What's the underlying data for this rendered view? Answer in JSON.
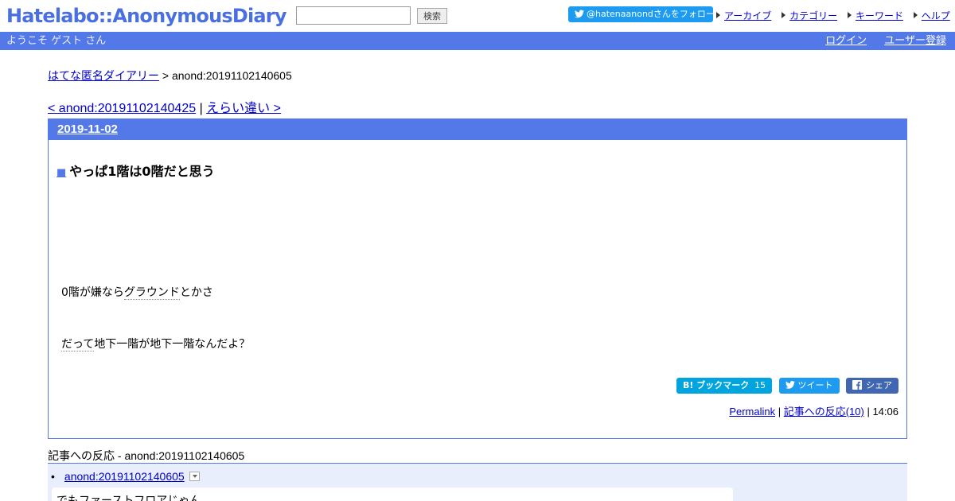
{
  "header": {
    "logo": "Hatelabo::AnonymousDiary",
    "search_placeholder": "",
    "search_button": "検索",
    "follow_label": "@hatenaanondさんをフォロー",
    "links": [
      "アーカイブ",
      "カテゴリー",
      "キーワード",
      "ヘルプ"
    ]
  },
  "nav": {
    "welcome": "ようこそ ゲスト さん",
    "login": "ログイン",
    "register": "ユーザー登録"
  },
  "breadcrumb": {
    "home": "はてな匿名ダイアリー",
    "separator": " > ",
    "current": "anond:20191102140605"
  },
  "pager": {
    "prev": "< anond:20191102140425",
    "separator": " | ",
    "next": "えらい違い >"
  },
  "entry": {
    "date": "2019-11-02",
    "title_marker": "■",
    "title": "やっぱ1階は0階だと思う",
    "line1_a": "0階が嫌なら",
    "line1_kw": "グラウンド",
    "line1_b": "とかさ",
    "line2_kw": "だって",
    "line2_b": "地下一階が地下一階なんだよ？",
    "bookmark_label": "B! ブックマーク",
    "bookmark_count": "15",
    "tweet_label": "ツイート",
    "share_label": "シェア",
    "permalink": "Permalink",
    "reactions": "記事への反応(10)",
    "time": "14:06",
    "meta_sep": " | "
  },
  "responses": {
    "title": "記事への反応 - anond:20191102140605",
    "bullet": "•",
    "item_link": "anond:20191102140605",
    "quote": "でもファーストフロアじゃん"
  },
  "colors": {
    "accent": "#5279e7",
    "link": "#0000cc",
    "twitter": "#1d9bf0",
    "hatena": "#00a4de",
    "facebook": "#4267b2"
  }
}
